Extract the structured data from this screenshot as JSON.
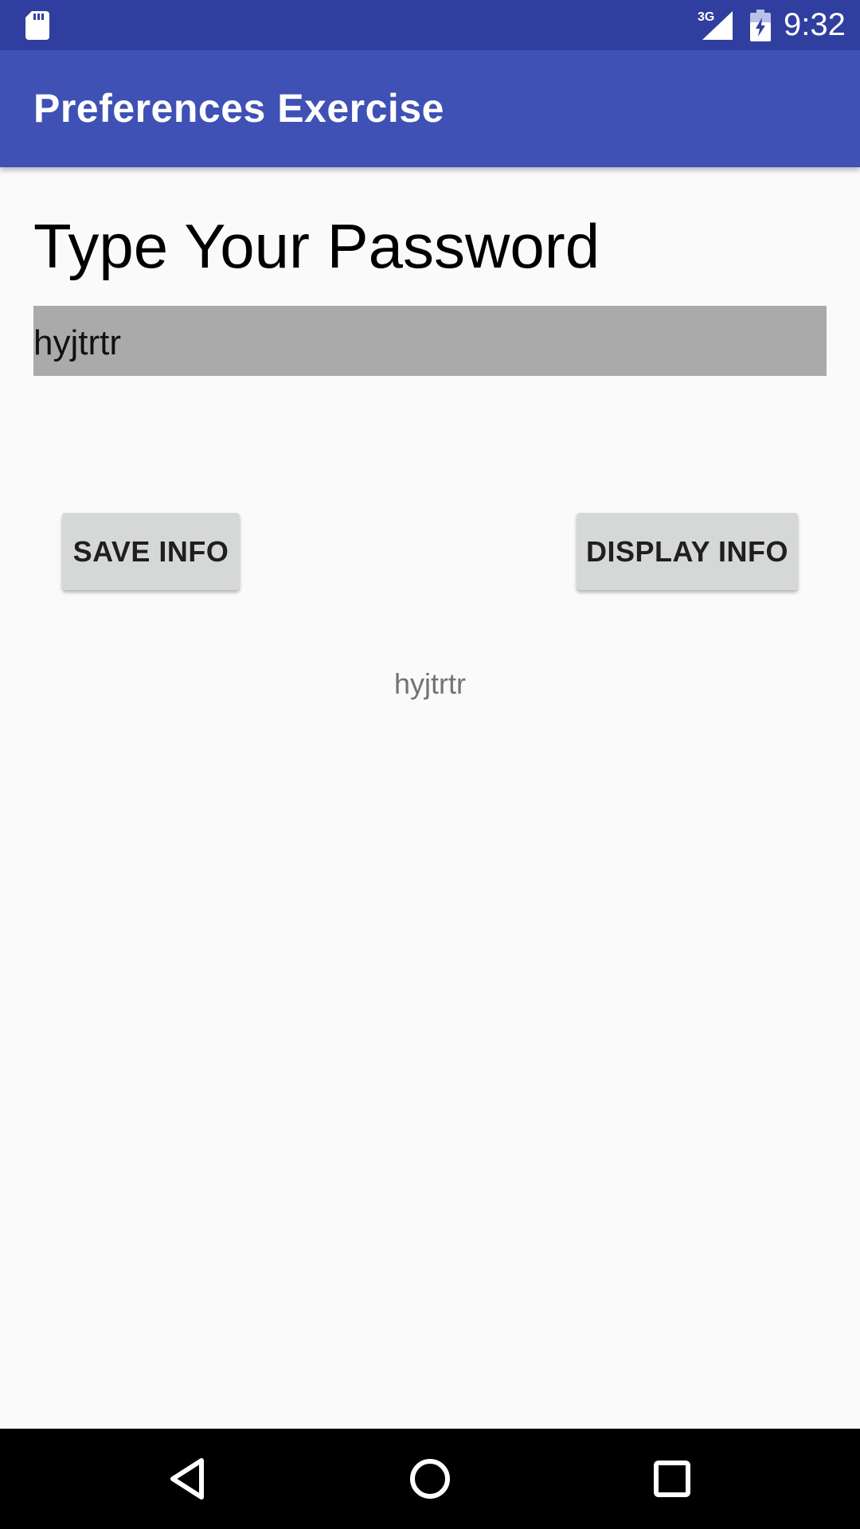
{
  "status_bar": {
    "network": "3G",
    "time": "9:32",
    "icons": [
      "sd-card-icon",
      "signal-icon",
      "battery-charging-icon"
    ]
  },
  "app_bar": {
    "title": "Preferences Exercise"
  },
  "main": {
    "heading": "Type Your Password",
    "password_field": {
      "value": "hyjtrtr",
      "placeholder": ""
    },
    "save_button_label": "SAVE INFO",
    "display_button_label": "DISPLAY INFO",
    "result_text": "hyjtrtr"
  },
  "nav_bar": {
    "icons": [
      "back-icon",
      "home-icon",
      "recents-icon"
    ]
  },
  "colors": {
    "status_bar": "#303f9f",
    "app_bar": "#3f51b5",
    "background": "#fafafa",
    "field_background": "#aaaaaa",
    "button_background": "#d6d7d7"
  }
}
